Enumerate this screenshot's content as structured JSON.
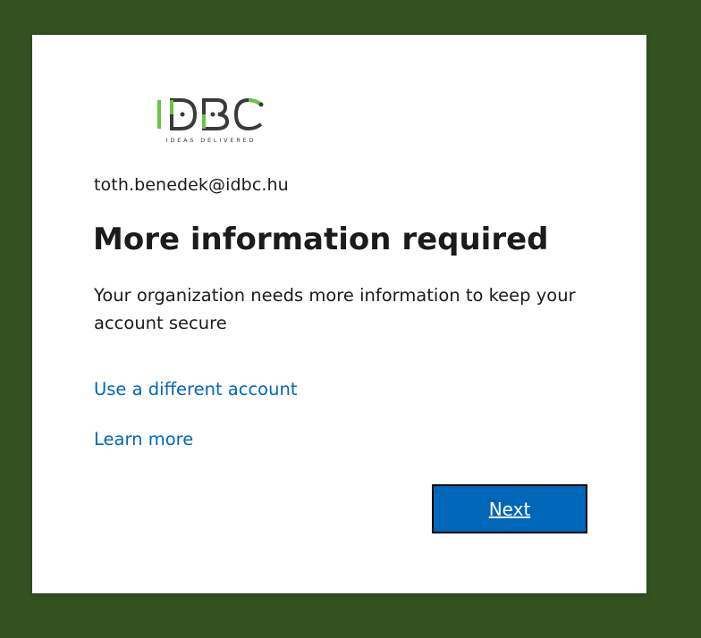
{
  "logo": {
    "letters": [
      "I",
      "D",
      "B",
      "C"
    ],
    "tagline": "IDEAS DELIVERED",
    "colors": {
      "green": "#6cc24a",
      "dark": "#3a3a3a"
    }
  },
  "identity": {
    "email": "toth.benedek@idbc.hu"
  },
  "heading": {
    "title": "More information required"
  },
  "body": {
    "description": "Your organization needs more information to keep your account secure"
  },
  "links": {
    "different_account": "Use a different account",
    "learn_more": "Learn more"
  },
  "actions": {
    "next_label": "Next"
  },
  "theme": {
    "background": "#33521f",
    "accent": "#0067b8",
    "card": "#ffffff"
  }
}
